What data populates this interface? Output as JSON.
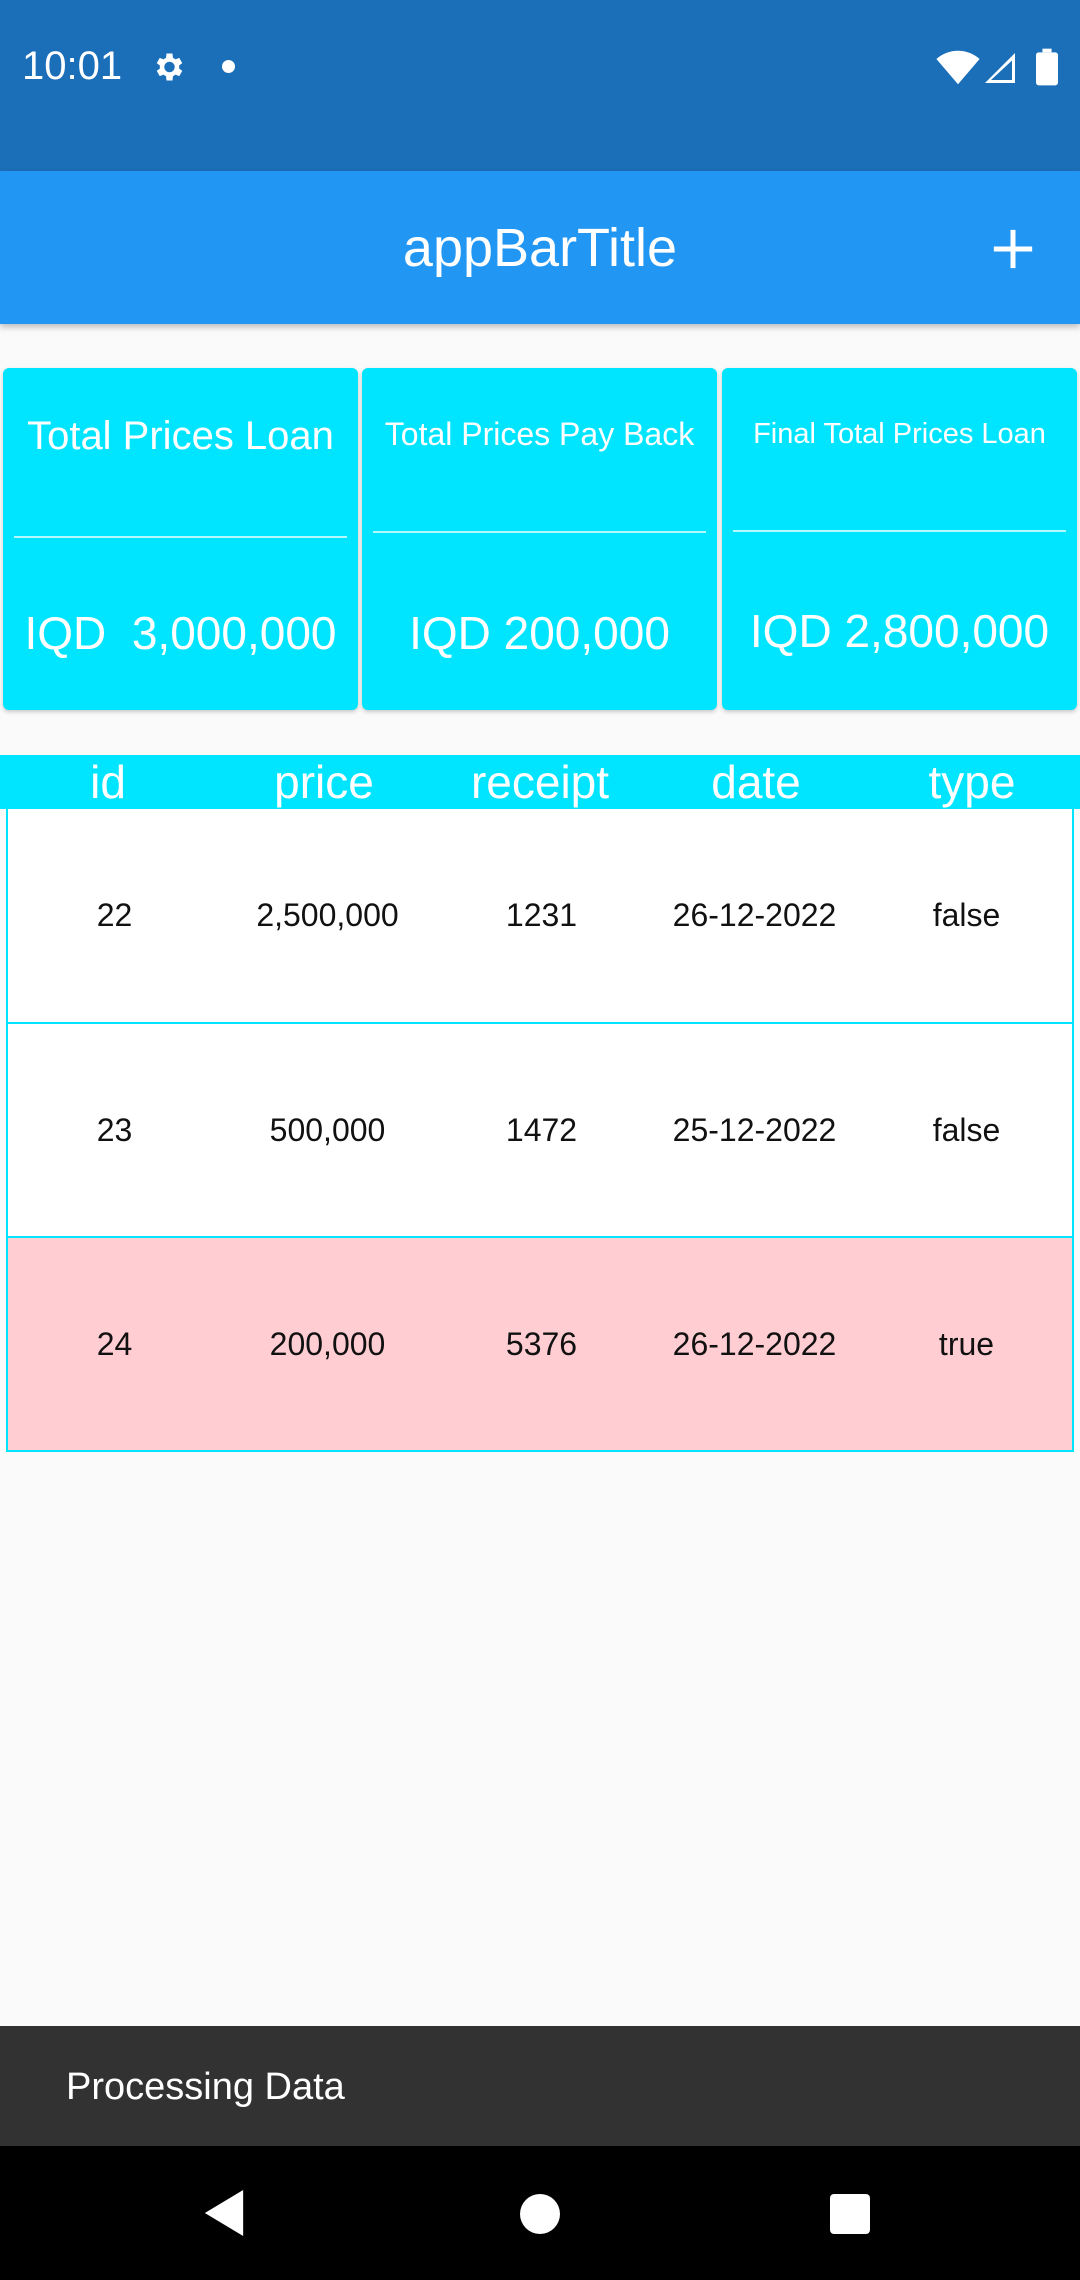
{
  "status_bar": {
    "time": "10:01",
    "icons": [
      "gear-icon",
      "dot-icon",
      "wifi-icon",
      "signal-icon",
      "battery-icon"
    ]
  },
  "app_bar": {
    "title": "appBarTitle",
    "action_icon": "plus-icon"
  },
  "summary_cards": [
    {
      "title": "Total Prices Loan",
      "amount": "IQD  3,000,000"
    },
    {
      "title": "Total Prices Pay Back",
      "amount": "IQD 200,000"
    },
    {
      "title": "Final Total Prices Loan",
      "amount": "IQD 2,800,000"
    }
  ],
  "table": {
    "columns": [
      "id",
      "price",
      "receipt",
      "date",
      "type"
    ],
    "rows": [
      {
        "id": "22",
        "price": "2,500,000",
        "receipt": "1231",
        "date": "26-12-2022",
        "type": "false"
      },
      {
        "id": "23",
        "price": "500,000",
        "receipt": "1472",
        "date": "25-12-2022",
        "type": "false"
      },
      {
        "id": "24",
        "price": "200,000",
        "receipt": "5376",
        "date": "26-12-2022",
        "type": "true"
      }
    ]
  },
  "snackbar": {
    "message": "Processing Data"
  },
  "colors": {
    "status_bar": "#1b6fb9",
    "app_bar": "#2196f3",
    "accent_cyan": "#00e5ff",
    "payback_row": "#ffcdd2",
    "snackbar": "#323232"
  }
}
